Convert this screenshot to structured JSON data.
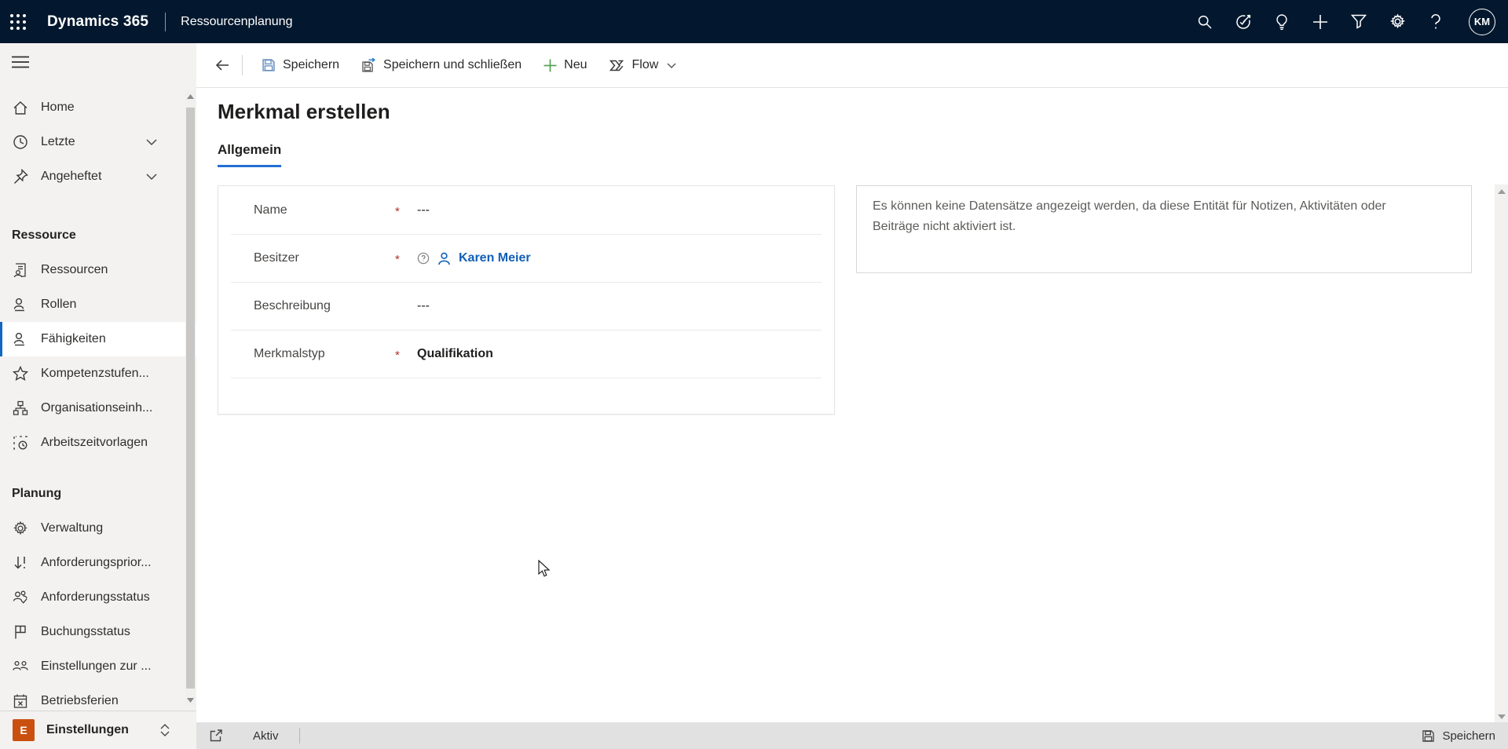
{
  "topbar": {
    "app_title": "Dynamics 365",
    "app_area": "Ressourcenplanung",
    "avatar_initials": "KM",
    "icons": [
      "waffle",
      "search",
      "task-target-check",
      "lightbulb",
      "add",
      "filter",
      "settings",
      "help"
    ]
  },
  "command_bar": {
    "save": "Speichern",
    "save_and_close": "Speichern und schließen",
    "new": "Neu",
    "flow": "Flow"
  },
  "sidebar": {
    "top_items": [
      {
        "label": "Home"
      },
      {
        "label": "Letzte",
        "expandable": true
      },
      {
        "label": "Angeheftet",
        "expandable": true
      }
    ],
    "sections": [
      {
        "header": "Ressource",
        "items": [
          "Ressourcen",
          "Rollen",
          "Fähigkeiten",
          "Kompetenzstufen...",
          "Organisationseinh...",
          "Arbeitszeitvorlagen"
        ]
      },
      {
        "header": "Planung",
        "items": [
          "Verwaltung",
          "Anforderungsprior...",
          "Anforderungsstatus",
          "Buchungsstatus",
          "Einstellungen zur ...",
          "Betriebsferien"
        ]
      }
    ],
    "selected_item": "Fähigkeiten",
    "footer": {
      "badge": "E",
      "label": "Einstellungen"
    }
  },
  "page": {
    "title": "Merkmal erstellen",
    "tab": "Allgemein"
  },
  "form": {
    "required_marker": "*",
    "fields": [
      {
        "label": "Name",
        "required": true,
        "value": "---"
      },
      {
        "label": "Besitzer",
        "required": true,
        "value": "Karen Meier"
      },
      {
        "label": "Beschreibung",
        "required": false,
        "value": "---"
      },
      {
        "label": "Merkmalstyp",
        "required": true,
        "value": "Qualifikation"
      }
    ]
  },
  "related_panel": {
    "message": "Es können keine Datensätze angezeigt werden, da diese Entität für Notizen, Aktivitäten oder Beiträge nicht aktiviert ist."
  },
  "status_bar": {
    "state": "Aktiv",
    "save_label": "Speichern"
  },
  "colors": {
    "header_bg": "#03182e",
    "accent_blue": "#1267c1",
    "tab_underline": "#2470d3",
    "required_red": "#b02e2e",
    "owner_link_blue": "#1160b7",
    "new_green": "#54a254",
    "env_badge_orange": "#ca5010",
    "sidebar_bg": "#f3f2f1",
    "statusbar_bg": "#e1e1e1"
  }
}
